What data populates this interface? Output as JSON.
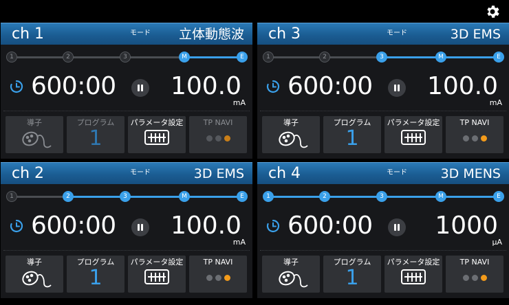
{
  "colors": {
    "accent_blue": "#3aa0ea",
    "header_blue": "#1b5d93",
    "orange": "#f39b1b",
    "panel_bg": "#17181b",
    "button_bg": "#303236"
  },
  "labels": {
    "mode": "モード",
    "electrode": "導子",
    "program": "プログラム",
    "params": "パラメータ設定",
    "tp_navi": "TP NAVI"
  },
  "icons": {
    "settings": "gear-icon",
    "timer": "clock-icon",
    "pause": "pause-icon",
    "electrode": "electrode-icon",
    "params": "equalizer-icon"
  },
  "channels": [
    {
      "ch": "ch 1",
      "mode": "立体動態波",
      "time": "600:00",
      "value": "100.0",
      "unit": "mA",
      "program": "1",
      "steps": [
        "1",
        "2",
        "3",
        "M",
        "E"
      ],
      "active_from": 3,
      "controls_disabled": [
        true,
        true,
        false,
        true
      ]
    },
    {
      "ch": "ch 2",
      "mode": "3D EMS",
      "time": "600:00",
      "value": "100.0",
      "unit": "mA",
      "program": "1",
      "steps": [
        "1",
        "2",
        "3",
        "M",
        "E"
      ],
      "active_from": 1,
      "controls_disabled": [
        false,
        false,
        false,
        false
      ]
    },
    {
      "ch": "ch 3",
      "mode": "3D EMS",
      "time": "600:00",
      "value": "100.0",
      "unit": "mA",
      "program": "1",
      "steps": [
        "1",
        "2",
        "3",
        "M",
        "E"
      ],
      "active_from": 2,
      "controls_disabled": [
        false,
        false,
        false,
        false
      ]
    },
    {
      "ch": "ch 4",
      "mode": "3D MENS",
      "time": "600:00",
      "value": "1000",
      "unit": "μA",
      "program": "1",
      "steps": [
        "1",
        "2",
        "3",
        "M",
        "E"
      ],
      "active_from": 0,
      "controls_disabled": [
        false,
        false,
        false,
        false
      ]
    }
  ]
}
